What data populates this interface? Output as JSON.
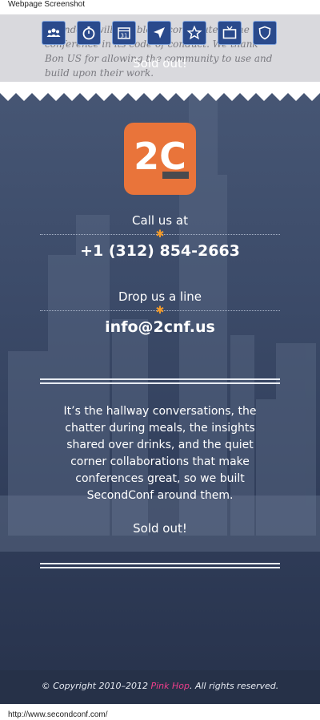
{
  "browser": {
    "window_title": "Webpage Screenshot",
    "status_url": "http://www.secondconf.com/"
  },
  "top_section": {
    "faded_text": "attendees will be able to contribute to the conference in its code of conduct. We thank Bon US for allowing the community to use and build upon their work.",
    "sold_out": "Sold out!"
  },
  "nav_icons": [
    "people-icon",
    "stopwatch-icon",
    "calendar-icon",
    "location-arrow-icon",
    "star-icon",
    "tv-icon",
    "shield-icon"
  ],
  "calendar_day": "31",
  "logo": {
    "text": "2C",
    "color": "#e9743a"
  },
  "contact": {
    "call_label": "Call us at",
    "phone": "+1 (312) 854-2663",
    "email_label": "Drop us a line",
    "email": "info@2cnf.us"
  },
  "blurb": "It’s the hallway conversations, the chatter during meals, the insights shared over drinks, and the quiet corner collaborations that make conferences great, so we built SecondConf around them.",
  "sold_out_bottom": "Sold out!",
  "footer": {
    "prefix": "© Copyright 2010–2012 ",
    "company": "Pink Hop",
    "suffix": ". All rights reserved."
  },
  "colors": {
    "accent_orange": "#e9743a",
    "footer_link_pink": "#ee3e8a",
    "nav_blue": "#2a4a8c"
  }
}
